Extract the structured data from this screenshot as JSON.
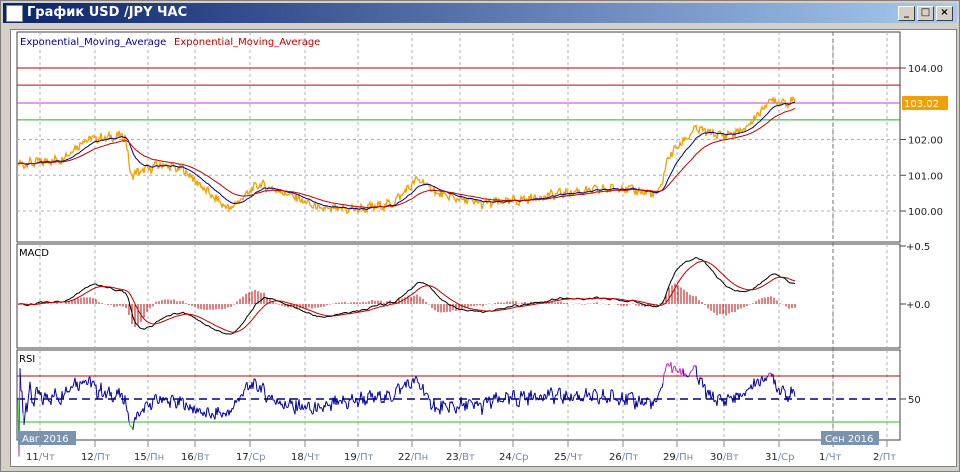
{
  "window": {
    "title": "График USD /JPY  ЧАС",
    "buttons": [
      "_",
      "□",
      "×"
    ]
  },
  "legend": {
    "ema_fast": "Exponential_Moving_Average",
    "ema_slow": "Exponential_Moving_Average",
    "colors": {
      "fast": "#00008b",
      "slow": "#c00000",
      "price": "#f0a000"
    }
  },
  "panels": {
    "macd_label": "MACD",
    "rsi_label": "RSI"
  },
  "price_axis": {
    "ticks": [
      "104.00",
      "102.00",
      "101.00",
      "100.00"
    ],
    "current": "103.02"
  },
  "macd_axis": {
    "ticks": [
      "+0.5",
      "+0.0"
    ]
  },
  "rsi_axis": {
    "ticks": [
      "50"
    ]
  },
  "x_axis": {
    "month_labels": [
      "Авг 2016",
      "Сен 2016"
    ],
    "days": [
      [
        "11",
        "Чт"
      ],
      [
        "12",
        "Пт"
      ],
      [
        "15",
        "Пн"
      ],
      [
        "16",
        "Вт"
      ],
      [
        "17",
        "Ср"
      ],
      [
        "18",
        "Чт"
      ],
      [
        "19",
        "Пт"
      ],
      [
        "22",
        "Пн"
      ],
      [
        "23",
        "Вт"
      ],
      [
        "24",
        "Ср"
      ],
      [
        "25",
        "Чт"
      ],
      [
        "26",
        "Пт"
      ],
      [
        "29",
        "Пн"
      ],
      [
        "30",
        "Вт"
      ],
      [
        "31",
        "Ср"
      ],
      [
        "1",
        "Чт"
      ],
      [
        "2",
        "Пт"
      ]
    ]
  },
  "chart_data": {
    "type": "line",
    "title": "USD/JPY H1",
    "ylim": [
      99.6,
      104.5
    ],
    "horizontal_levels": [
      {
        "value": 104.0,
        "color": "#c00000"
      },
      {
        "value": 103.52,
        "color": "#c00000"
      },
      {
        "value": 103.02,
        "color": "#c040c0"
      },
      {
        "value": 102.55,
        "color": "#20b020"
      }
    ],
    "price": [
      [
        -0.4,
        101.3
      ],
      [
        0.4,
        101.45
      ],
      [
        0.85,
        102.0
      ],
      [
        1.6,
        102.1
      ],
      [
        1.7,
        101.0
      ],
      [
        2.25,
        101.3
      ],
      [
        2.7,
        101.15
      ],
      [
        3.2,
        100.45
      ],
      [
        3.55,
        100.05
      ],
      [
        4.1,
        100.75
      ],
      [
        4.7,
        100.45
      ],
      [
        5.25,
        100.05
      ],
      [
        6.0,
        100.05
      ],
      [
        6.6,
        100.2
      ],
      [
        7.1,
        100.9
      ],
      [
        7.5,
        100.45
      ],
      [
        8.3,
        100.2
      ],
      [
        9.0,
        100.3
      ],
      [
        9.8,
        100.5
      ],
      [
        10.9,
        100.65
      ],
      [
        11.6,
        100.45
      ],
      [
        11.8,
        101.55
      ],
      [
        12.3,
        102.3
      ],
      [
        12.8,
        102.1
      ],
      [
        13.2,
        102.25
      ],
      [
        13.7,
        103.1
      ],
      [
        14.3,
        103.02
      ]
    ],
    "rsi_levels": [
      70,
      50,
      30
    ]
  }
}
